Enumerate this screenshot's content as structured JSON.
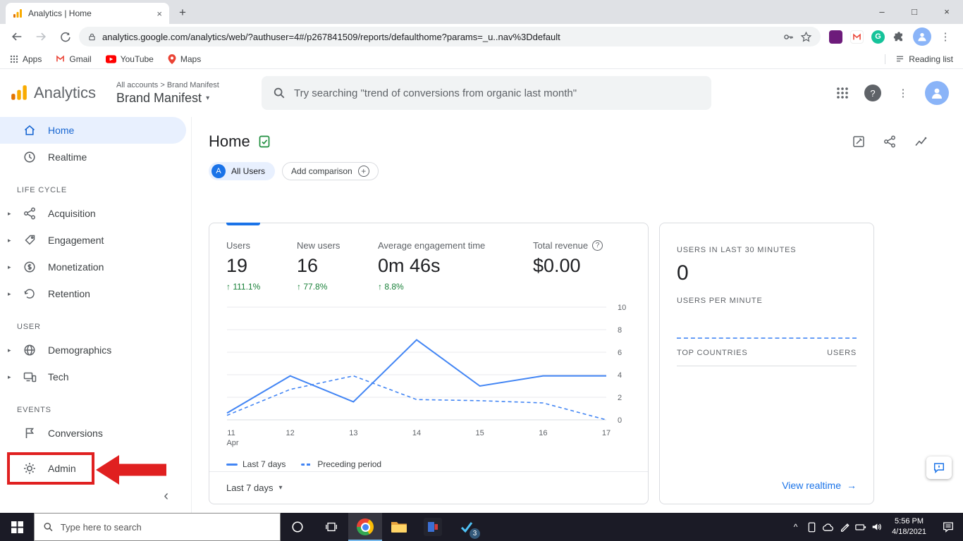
{
  "colors": {
    "accent_blue": "#1a73e8",
    "chart_line_blue": "#4285f4",
    "positive_green": "#188038",
    "annotation_red": "#e02020",
    "selected_nav_bg": "#e8f0fe"
  },
  "icons": {
    "up_arrow": "↑",
    "caret_down": "▾",
    "arrow_right": "→",
    "plus": "+",
    "close": "×",
    "minimize": "–",
    "maximize": "□",
    "kebab": "⋮",
    "help_mark": "?",
    "collapse_chevron": "‹",
    "expander": "▸",
    "tray_chevron": "^"
  },
  "browser": {
    "tab_title": "Analytics | Home",
    "url": "analytics.google.com/analytics/web/?authuser=4#/p267841509/reports/defaulthome?params=_u..nav%3Ddefault",
    "bookmarks_bar": {
      "apps": "Apps",
      "gmail": "Gmail",
      "youtube": "YouTube",
      "maps": "Maps",
      "reading_list": "Reading list"
    }
  },
  "ga_header": {
    "product_name": "Analytics",
    "breadcrumb": "All accounts > Brand Manifest",
    "account_selector": "Brand Manifest",
    "search_placeholder": "Try searching \"trend of conversions from organic last month\""
  },
  "sidebar": {
    "home": "Home",
    "realtime": "Realtime",
    "section_lifecycle": "LIFE CYCLE",
    "lifecycle": [
      "Acquisition",
      "Engagement",
      "Monetization",
      "Retention"
    ],
    "section_user": "USER",
    "user": [
      "Demographics",
      "Tech"
    ],
    "section_events": "EVENTS",
    "events": [
      "Conversions"
    ],
    "admin": "Admin"
  },
  "main": {
    "page_title": "Home",
    "comparison": {
      "all_users_avatar": "A",
      "all_users_label": "All Users",
      "add_comparison_label": "Add comparison"
    },
    "metrics": [
      {
        "label": "Users",
        "value": "19",
        "delta": "111.1%"
      },
      {
        "label": "New users",
        "value": "16",
        "delta": "77.8%"
      },
      {
        "label": "Average engagement time",
        "value": "0m 46s",
        "delta": "8.8%"
      },
      {
        "label": "Total revenue",
        "value": "$0.00",
        "delta": ""
      }
    ],
    "range_selector_label": "Last 7 days",
    "realtime_card": {
      "users_30_label": "USERS IN LAST 30 MINUTES",
      "users_30_value": "0",
      "users_per_minute_label": "USERS PER MINUTE",
      "top_countries_label": "TOP COUNTRIES",
      "users_col_label": "USERS",
      "view_realtime_label": "View realtime"
    }
  },
  "chart_data": {
    "type": "line",
    "x": [
      "11",
      "12",
      "13",
      "14",
      "15",
      "16",
      "17"
    ],
    "x_month_label": "Apr",
    "series": [
      {
        "name": "Last 7 days",
        "style": "solid",
        "values": [
          0.6,
          3.9,
          1.6,
          7.1,
          3.0,
          3.9,
          3.9
        ]
      },
      {
        "name": "Preceding period",
        "style": "dashed",
        "values": [
          0.4,
          2.7,
          3.9,
          1.8,
          1.7,
          1.5,
          0
        ]
      }
    ],
    "ylim": [
      0,
      10
    ],
    "yticks": [
      0,
      2,
      4,
      6,
      8,
      10
    ],
    "legend_position": "bottom",
    "line_color": "#4285f4",
    "grid": true
  },
  "taskbar": {
    "search_placeholder": "Type here to search",
    "badge_count": "3",
    "time": "5:56 PM",
    "date": "4/18/2021"
  }
}
